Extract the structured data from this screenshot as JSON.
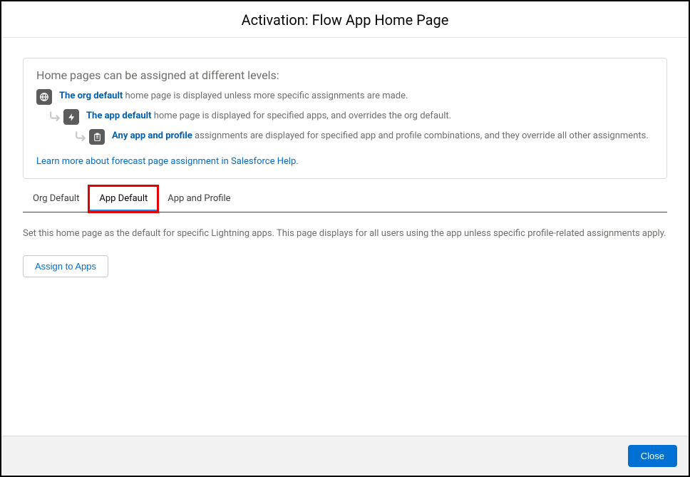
{
  "header": {
    "title": "Activation: Flow App Home Page"
  },
  "intro": "Home pages can be assigned at different levels:",
  "levels": {
    "org": {
      "bold": "The org default",
      "text": " home page is displayed unless more specific assignments are made."
    },
    "app": {
      "bold": "The app default",
      "text": " home page is displayed for specified apps, and overrides the org default."
    },
    "app_profile": {
      "bold": "Any app and profile",
      "text": " assignments are displayed for specified app and profile combinations, and they override all other assignments."
    }
  },
  "learn_more": "Learn more about forecast page assignment in Salesforce Help.",
  "tabs": {
    "org_default": "Org Default",
    "app_default": "App Default",
    "app_and_profile": "App and Profile",
    "active": "app_default"
  },
  "tab_content": {
    "app_default_desc": "Set this home page as the default for specific Lightning apps. This page displays for all users using the app unless specific profile-related assignments apply.",
    "assign_to_apps": "Assign to Apps"
  },
  "footer": {
    "close": "Close"
  }
}
